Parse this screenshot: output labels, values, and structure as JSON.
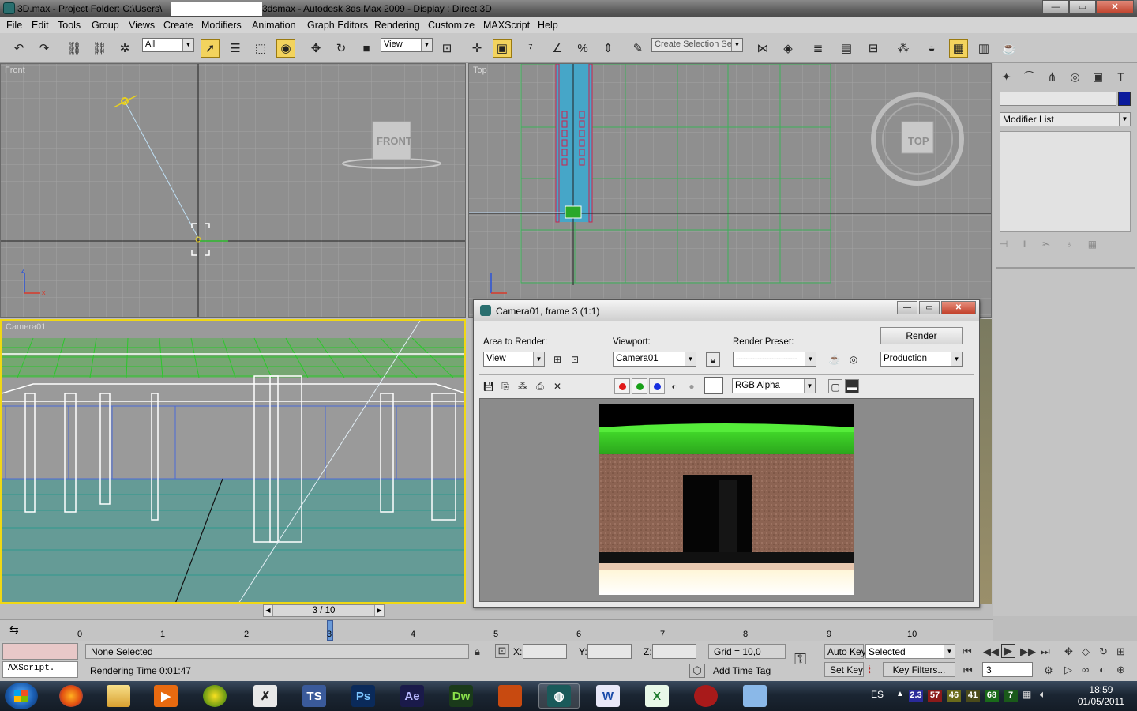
{
  "window": {
    "title_left": "3D.max     - Project Folder: C:\\Users\\",
    "title_right": "3dsmax     - Autodesk 3ds Max  2009     - Display : Direct 3D",
    "minimize": "—",
    "maximize": "▭",
    "close": "✕"
  },
  "menu": [
    "File",
    "Edit",
    "Tools",
    "Group",
    "Views",
    "Create",
    "Modifiers",
    "Animation",
    "Graph Editors",
    "Rendering",
    "Customize",
    "MAXScript",
    "Help"
  ],
  "toolbar": {
    "filter_value": "All",
    "refcoord_value": "View",
    "selection_set_placeholder": "Create Selection Set"
  },
  "viewports": {
    "front": "Front",
    "top": "Top",
    "camera": "Camera01",
    "front_cube": "FRONT",
    "top_cube": "TOP"
  },
  "command_panel": {
    "modifier_list": "Modifier List",
    "object_color": "#0a1a9c"
  },
  "render_window": {
    "title": "Camera01, frame 3 (1:1)",
    "area_label": "Area to Render:",
    "area_value": "View",
    "viewport_label": "Viewport:",
    "viewport_value": "Camera01",
    "preset_label": "Render Preset:",
    "preset_value": "--------------------------",
    "render_button": "Render",
    "production_value": "Production",
    "channel_value": "RGB Alpha"
  },
  "timeline": {
    "slider_text": "3 / 10",
    "ticks": [
      "0",
      "1",
      "2",
      "3",
      "4",
      "5",
      "6",
      "7",
      "8",
      "9",
      "10"
    ],
    "current_frame": "3"
  },
  "status": {
    "maxscript": "AXScript.",
    "selection": "None Selected",
    "rendering_time": "Rendering Time  0:01:47",
    "x_label": "X:",
    "y_label": "Y:",
    "z_label": "Z:",
    "grid": "Grid = 10,0",
    "add_time_tag": "Add Time Tag",
    "auto_key": "Auto Key",
    "set_key": "Set Key",
    "selected": "Selected",
    "key_filters": "Key Filters..."
  },
  "taskbar": {
    "language": "ES",
    "time": "18:59",
    "date": "01/05/2011",
    "tray_numbers": [
      "2.3",
      "57",
      "46",
      "41",
      "68",
      "7"
    ],
    "apps": [
      "firefox",
      "explorer",
      "media-player",
      "norton",
      "xara",
      "toolbook",
      "Ps",
      "Ae",
      "Dw",
      "flash",
      "3dsmax",
      "word",
      "excel",
      "acrobat",
      "paint"
    ]
  }
}
